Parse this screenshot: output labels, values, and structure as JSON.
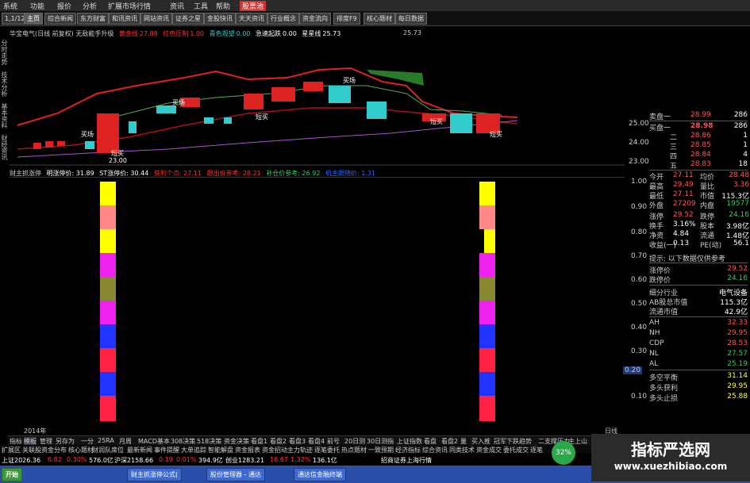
{
  "menubar": {
    "items": [
      "系统",
      "功能",
      "报价",
      "分析",
      "扩展市场行情",
      "资讯",
      "工具",
      "帮助"
    ],
    "badge": "股票池"
  },
  "toolbar": {
    "buttons": [
      "1,1/12",
      "主页",
      "综合新闻",
      "东方财富",
      "和讯资讯",
      "网站资讯",
      "证券之星",
      "金股快讯",
      "天天资讯",
      "行业概念",
      "资金流向",
      "排度F9",
      "核心题材",
      "每日数据"
    ]
  },
  "left_tabs": [
    "分时走势",
    "技术分析",
    "基本资料",
    "财经资讯"
  ],
  "main_header": {
    "title": "华宝电气(日线 前复权) 无敌能手升级",
    "items": [
      {
        "label": "黄金线",
        "value": "27.88",
        "color": "#ff3333"
      },
      {
        "label": "红色压制",
        "value": "1.00",
        "color": "#ff3333"
      },
      {
        "label": "青色观望",
        "value": "0.00",
        "color": "#33cccc"
      },
      {
        "label": "急速起跌",
        "value": "0.00",
        "color": "#ffffff"
      },
      {
        "label": "星星线",
        "value": "25.73",
        "color": "#ffffff"
      }
    ],
    "right_value": "25.73"
  },
  "sub_header": {
    "title": "财主抓涨停",
    "items": [
      {
        "text": "明涨停价: 31.89",
        "color": "#ffffff"
      },
      {
        "text": "ST涨停价: 30.44",
        "color": "#ffffff"
      },
      {
        "text": "获利个点: 27.11",
        "color": "#ff3333"
      },
      {
        "text": "跟出价参考: 28.21",
        "color": "#ff3333"
      },
      {
        "text": "补仓价参考: 26.92",
        "color": "#33cc66"
      },
      {
        "text": "机主跟随价: 1.31",
        "color": "#3366ff"
      }
    ]
  },
  "price_axis": [
    "25.00",
    "24.00",
    "23.00"
  ],
  "indicator_axis": [
    "1.00",
    "0.90",
    "0.80",
    "0.70",
    "0.60",
    "0.50",
    "0.40",
    "0.30",
    "0.20",
    "0.10"
  ],
  "chart_annotations": [
    "买场",
    "买场",
    "短买",
    "买场",
    "短买",
    "短买",
    "短买",
    "23.00"
  ],
  "year_label": "2014年",
  "date_label": "日线",
  "order_book": {
    "sell_top": {
      "label": "卖盘一",
      "price": "28.99",
      "vol": "286"
    },
    "buys": [
      {
        "label": "买盘一",
        "price": "28.98",
        "vol": "286"
      },
      {
        "label": "二",
        "price": "28.86",
        "vol": "1"
      },
      {
        "label": "三",
        "price": "28.85",
        "vol": "1"
      },
      {
        "label": "四",
        "price": "28.84",
        "vol": "4"
      },
      {
        "label": "五",
        "price": "28.83",
        "vol": "18"
      }
    ]
  },
  "quote": [
    {
      "l1": "今开",
      "v1": "27.11",
      "l2": "均价",
      "v2": "28.48"
    },
    {
      "l1": "最高",
      "v1": "29.49",
      "l2": "量比",
      "v2": "3.36"
    },
    {
      "l1": "最低",
      "v1": "27.11",
      "l2": "市值",
      "v2": "115.3亿"
    },
    {
      "l1": "外盘",
      "v1": "27209",
      "l2": "内盘",
      "v2": "19577"
    },
    {
      "l1": "涨停",
      "v1": "29.52",
      "l2": "跌停",
      "v2": "24.16"
    },
    {
      "l1": "换手",
      "v1": "3.16%",
      "l2": "股本",
      "v2": "3.98亿"
    },
    {
      "l1": "净资",
      "v1": "4.84",
      "l2": "流通",
      "v2": "1.48亿"
    },
    {
      "l1": "收益(一)",
      "v1": "0.13",
      "l2": "PE(动)",
      "v2": "56.1"
    }
  ],
  "notice": "提示: 以下数据仅供参考",
  "ref_rows": [
    {
      "label": "涨停价",
      "value": "29.52"
    },
    {
      "label": "跌停价",
      "value": "24.16"
    }
  ],
  "industry_rows": [
    {
      "label": "细分行业",
      "value": "电气设备"
    },
    {
      "label": "AB股总市值",
      "value": "115.3亿"
    },
    {
      "label": "流通市值",
      "value": "42.9亿"
    }
  ],
  "indicator_rows": [
    {
      "label": "AH",
      "value": "32.33"
    },
    {
      "label": "NH",
      "value": "29.95"
    },
    {
      "label": "CDP",
      "value": "28.53"
    },
    {
      "label": "NL",
      "value": "27.57"
    },
    {
      "label": "AL",
      "value": "25.19"
    }
  ],
  "position_rows": [
    {
      "label": "多空平衡",
      "value": "31.14"
    },
    {
      "label": "多头获利",
      "value": "29.95"
    },
    {
      "label": "多头止损",
      "value": "25.88"
    }
  ],
  "bottom_tabs": [
    "指标",
    "模板",
    "管理",
    "另存为",
    "一分",
    "25RA",
    "月周",
    "MACD基本",
    "308决策",
    "518决策",
    "资金决策",
    "看盘1",
    "看盘2",
    "看盘3",
    "看盘4",
    "前号",
    "20日测",
    "30日测指",
    "上证指数",
    "看盘",
    "看盘2",
    "量",
    "买入推",
    "冠军下跌趋势",
    "二支撑压力",
    "主上山"
  ],
  "bottom_tabs2": [
    "扩展区",
    "关联股",
    "资金分布",
    "核心题材",
    "财润队席位",
    "最新新闻",
    "事件提醒",
    "大单追踪",
    "智能解盘",
    "资金报表",
    "资金招动",
    "主力轨迹",
    "逐笔委托",
    "热点题材",
    "一致预期",
    "经济指标",
    "综合资讯",
    "同类技术",
    "资金成交",
    "委托成交",
    "逐笔"
  ],
  "index_bar": [
    {
      "text": "上证2026.36",
      "color": "#ffffff"
    },
    {
      "text": "6.82",
      "color": "#ff3333"
    },
    {
      "text": "0.30%",
      "color": "#ff3333"
    },
    {
      "text": "576.0亿",
      "color": "#ffffff"
    },
    {
      "text": "沪深2158.66",
      "color": "#ffffff"
    },
    {
      "text": "0.19",
      "color": "#ff3333"
    },
    {
      "text": "0.01%",
      "color": "#ff3333"
    },
    {
      "text": "394.9亿",
      "color": "#ffffff"
    },
    {
      "text": "创业1283.21",
      "color": "#ffffff"
    },
    {
      "text": "16.67",
      "color": "#ff3333"
    },
    {
      "text": "1.32%",
      "color": "#ff3333"
    },
    {
      "text": "136.1亿",
      "color": "#ffffff"
    },
    {
      "text": "招商证券上海行情",
      "color": "#ffffff"
    }
  ],
  "taskbar": {
    "start": "开始",
    "tasks": [
      "财主抓涨停公式(",
      "股份管理器 - 通达",
      "通达信金融终端"
    ],
    "percent": "32%"
  },
  "watermark": {
    "title": "指标严选网",
    "url": "www.xuezhibiao.com"
  }
}
